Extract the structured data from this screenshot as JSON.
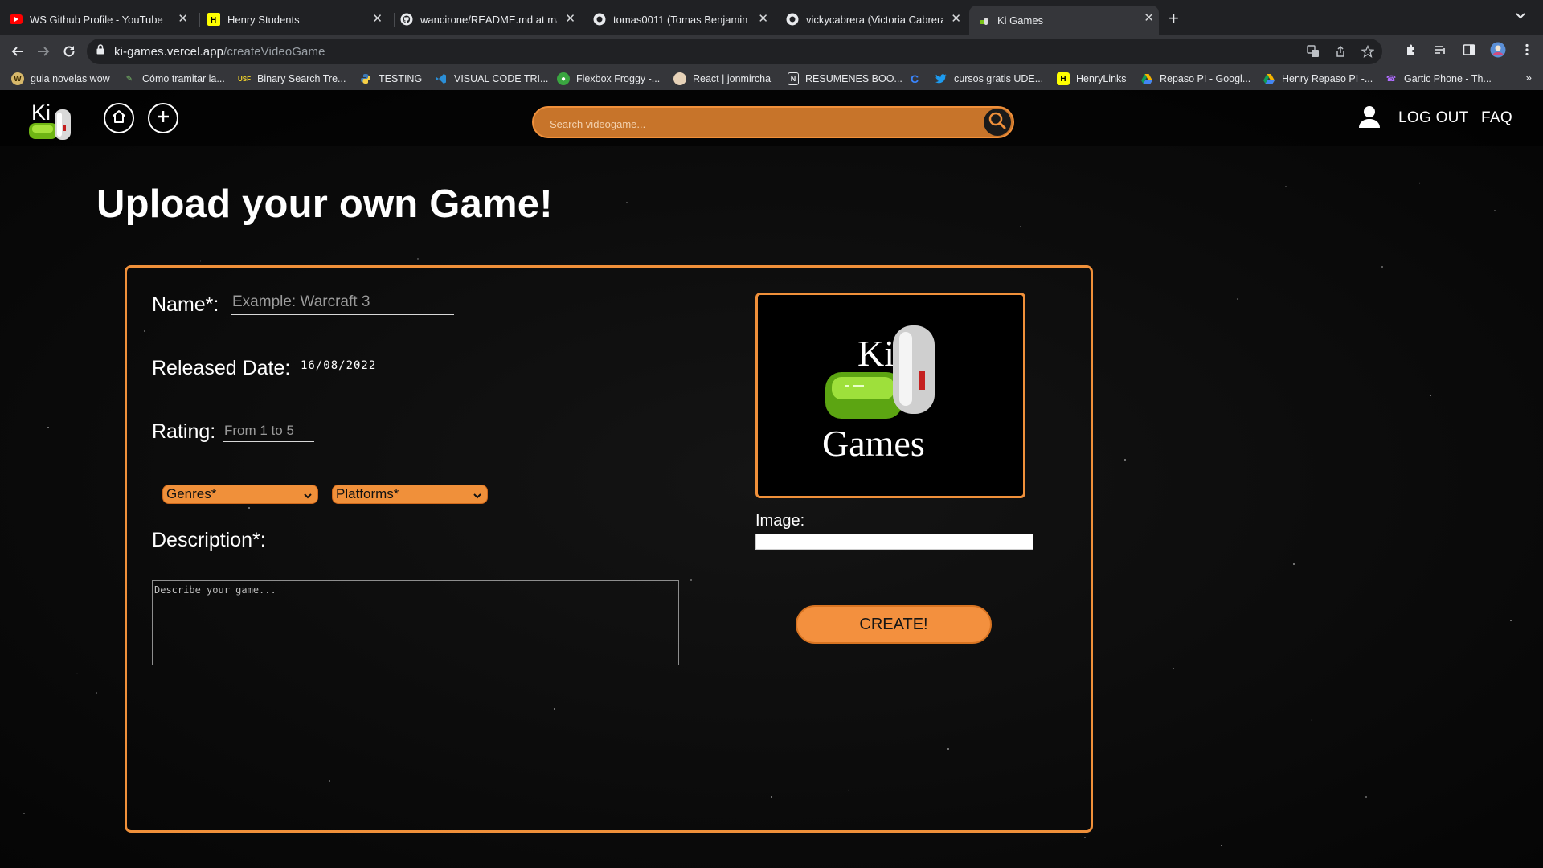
{
  "browser": {
    "tabs": [
      {
        "title": "WS Github Profile - YouTube",
        "icon": "youtube-icon"
      },
      {
        "title": "Henry Students",
        "icon": "henry-icon"
      },
      {
        "title": "wancirone/README.md at main",
        "icon": "github-icon"
      },
      {
        "title": "tomas0011 (Tomas Benjamin V",
        "icon": "github-icon"
      },
      {
        "title": "vickycabrera (Victoria Cabrera",
        "icon": "github-icon"
      },
      {
        "title": "Ki Games",
        "icon": "ki-games-icon",
        "active": true
      }
    ],
    "url_domain": "ki-games.vercel.app",
    "url_path": "/createVideoGame",
    "bookmarks": [
      {
        "label": "guia novelas wow"
      },
      {
        "label": "Cómo tramitar la..."
      },
      {
        "label": "Binary Search Tre..."
      },
      {
        "label": "TESTING"
      },
      {
        "label": "VISUAL CODE TRI..."
      },
      {
        "label": "Flexbox Froggy -..."
      },
      {
        "label": "React | jonmircha"
      },
      {
        "label": "RESUMENES BOO..."
      },
      {
        "label": ""
      },
      {
        "label": "cursos gratis UDE..."
      },
      {
        "label": "HenryLinks"
      },
      {
        "label": "Repaso PI - Googl..."
      },
      {
        "label": "Henry Repaso PI -..."
      },
      {
        "label": "Gartic Phone - Th..."
      }
    ]
  },
  "navbar": {
    "logo_text": "Ki",
    "search_placeholder": "Search videogame...",
    "logout_label": "LOG OUT",
    "faq_label": "FAQ"
  },
  "page": {
    "title": "Upload your own Game!"
  },
  "form": {
    "name_label": "Name*:",
    "name_placeholder": "Example: Warcraft 3",
    "date_label": "Released Date:",
    "date_value": "16/08/2022",
    "rating_label": "Rating:",
    "rating_placeholder": "From 1 to 5",
    "genres_select": "Genres*",
    "platforms_select": "Platforms*",
    "description_label": "Description*:",
    "description_placeholder": "Describe your game...",
    "image_label": "Image:",
    "create_button": "CREATE!",
    "preview_logo_top": "Ki",
    "preview_logo_bottom": "Games"
  },
  "colors": {
    "accent": "#f0903a",
    "search_bg": "#c7742a",
    "page_bg": "#070707"
  }
}
